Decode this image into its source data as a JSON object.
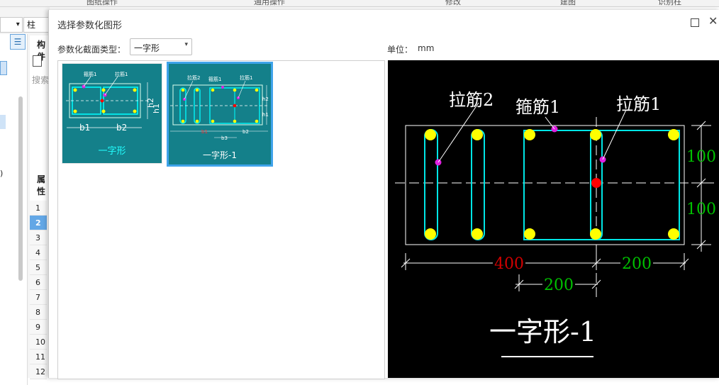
{
  "background": {
    "top_tabs": [
      "图纸操作",
      "通用操作",
      "修改",
      "建图",
      "识别柱"
    ],
    "left_dropdown_value": "柱",
    "left_dropdown2_chevron": "chevron-down-icon",
    "panel_title": "构件",
    "search_placeholder": "搜索",
    "properties_title": "属性",
    "row_numbers": [
      "1",
      "2",
      "3",
      "4",
      "5",
      "6",
      "7",
      "8",
      "9",
      "10",
      "11",
      "12"
    ],
    "selected_row": "2",
    "panel_close": "✕"
  },
  "dialog": {
    "title": "选择参数化图形",
    "type_label": "参数化截面类型：",
    "type_value": "一字形",
    "unit_label": "单位：",
    "unit_value": "mm",
    "thumbnails": [
      {
        "caption": "一字形",
        "labels": {
          "stirrup": "箍筋1",
          "tie": "拉筋1",
          "b1": "b1",
          "b2": "b2",
          "h1": "h1",
          "h2": "h2"
        }
      },
      {
        "caption": "一字形-1",
        "labels": {
          "tie2": "拉筋2",
          "stirrup": "箍筋1",
          "tie1": "拉筋1",
          "b1": "b1",
          "b2": "b2",
          "b3": "b3",
          "h1": "h1",
          "h2": "h2"
        }
      }
    ],
    "selected_thumbnail": "一字形-1"
  },
  "preview": {
    "title": "一字形-1",
    "label_tie2": "拉筋2",
    "label_stirrup": "箍筋1",
    "label_tie1": "拉筋1",
    "dim_h_top": "100",
    "dim_h_bottom": "100",
    "dim_b1": "400",
    "dim_b2": "200",
    "dim_b3": "200",
    "colors": {
      "background": "#000000",
      "rebar": "#00e6e6",
      "bar_dot": "#ffff00",
      "editable_dim": "#00c000",
      "fixed_dim": "#d00000",
      "marker": "#e020e0",
      "center": "#ff0000",
      "outline": "#ffffff"
    }
  }
}
